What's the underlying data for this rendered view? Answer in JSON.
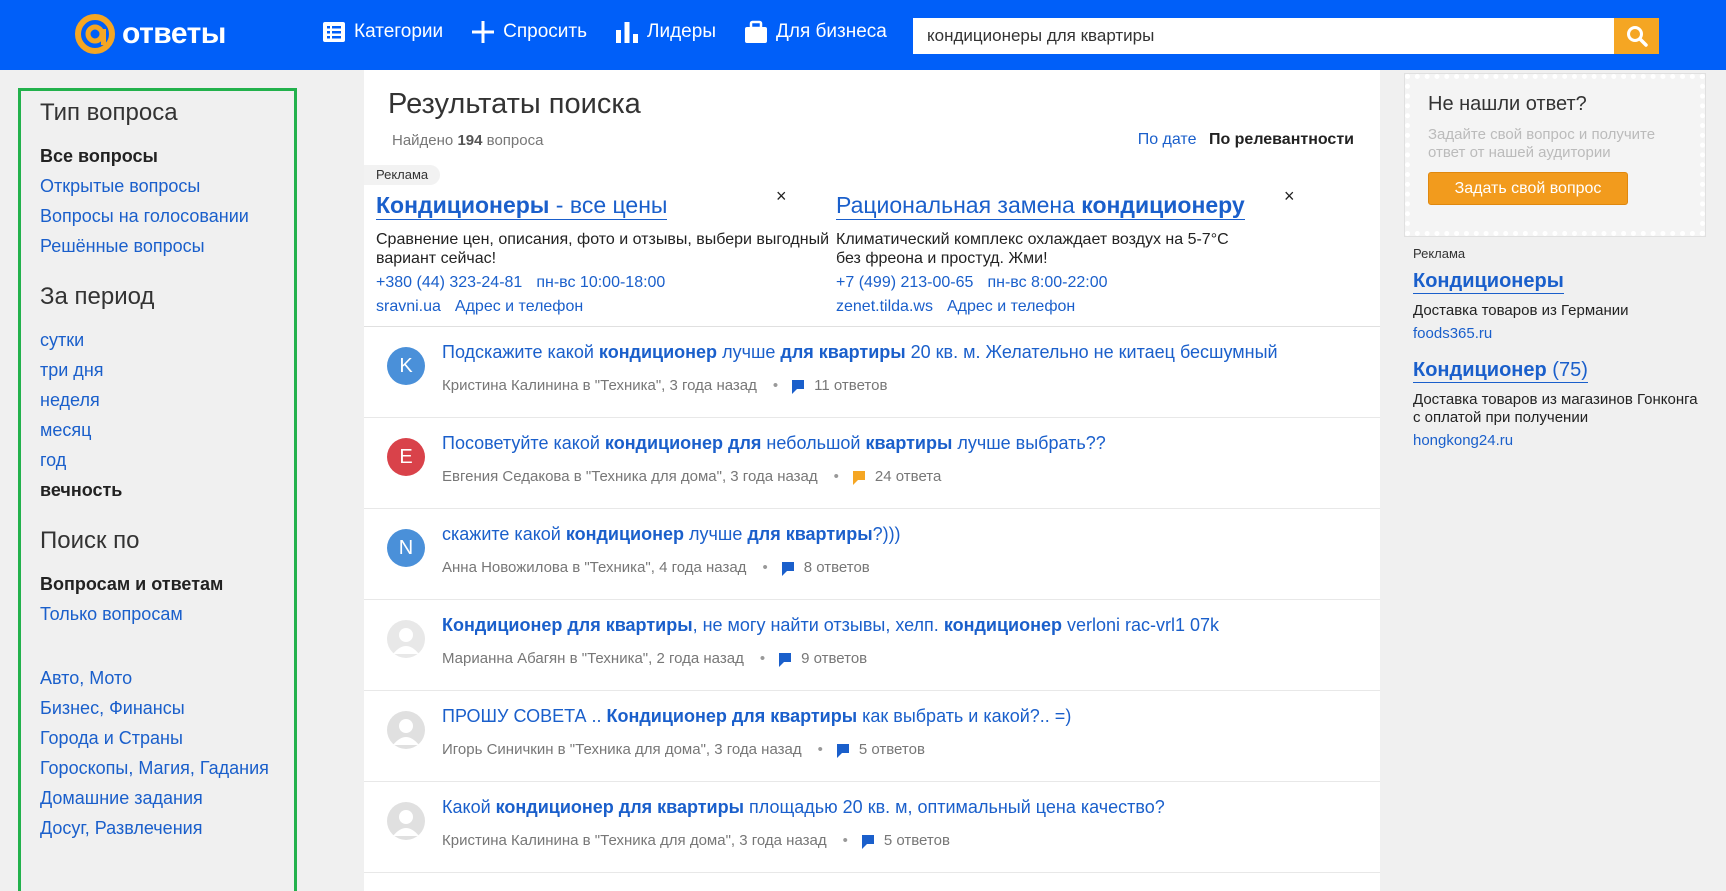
{
  "header": {
    "logo_text": "ответы",
    "nav": {
      "categories": "Категории",
      "ask": "Спросить",
      "leaders": "Лидеры",
      "business": "Для бизнеса"
    },
    "search_value": "кондиционеры для квартиры"
  },
  "sidebar": {
    "type_heading": "Тип вопроса",
    "type_items": [
      "Все вопросы",
      "Открытые вопросы",
      "Вопросы на голосовании",
      "Решённые вопросы"
    ],
    "period_heading": "За период",
    "period_items": [
      "сутки",
      "три дня",
      "неделя",
      "месяц",
      "год",
      "вечность"
    ],
    "searchby_heading": "Поиск по",
    "searchby_items": [
      "Вопросам и ответам",
      "Только вопросам"
    ],
    "categories": [
      "Авто, Мото",
      "Бизнес, Финансы",
      "Города и Страны",
      "Гороскопы, Магия, Гадания",
      "Домашние задания",
      "Досуг, Развлечения"
    ]
  },
  "main": {
    "title": "Результаты поиска",
    "found_prefix": "Найдено",
    "found_count": "194",
    "found_suffix": "вопроса",
    "sort_date": "По дате",
    "sort_relevance": "По релевантности",
    "ad_label": "Реклама",
    "close_symbol": "×",
    "ads": [
      {
        "title_bold": "Кондиционеры",
        "title_rest": " - все цены",
        "desc": "Сравнение цен, описания, фото и отзывы, выбери выгодный вариант сейчас!",
        "phone": "+380 (44) 323-24-81",
        "hours": "пн-вс 10:00-18:00",
        "domain": "sravni.ua",
        "address": "Адрес и телефон"
      },
      {
        "title_rest": "Рациональная замена ",
        "title_bold": "кондиционеру",
        "desc": "Климатический комплекс охлаждает воздух на 5-7°C без фреона и простуд. Жми!",
        "phone": "+7 (499) 213-00-65",
        "hours": "пн-вс 8:00-22:00",
        "domain": "zenet.tilda.ws",
        "address": "Адрес и телефон"
      }
    ],
    "questions": [
      {
        "avatar_letter": "K",
        "avatar_color": "#4a90d9",
        "title_parts": [
          [
            "Подскажите какой ",
            false
          ],
          [
            "кондиционер",
            true
          ],
          [
            " лучше ",
            false
          ],
          [
            "для квартиры",
            true
          ],
          [
            " 20 кв. м. Желательно не китаец бесшумный",
            false
          ]
        ],
        "meta": "Кристина Калинина в \"Техника\", 3 года назад",
        "answers": "11 ответов",
        "bubble_color": "#1a5fcb"
      },
      {
        "avatar_letter": "E",
        "avatar_color": "#d9424a",
        "title_parts": [
          [
            "Посоветуйте какой ",
            false
          ],
          [
            "кондиционер для",
            true
          ],
          [
            " небольшой ",
            false
          ],
          [
            "квартиры",
            true
          ],
          [
            " лучше выбрать??",
            false
          ]
        ],
        "meta": "Евгения Седакова в \"Техника для дома\", 3 года назад",
        "answers": "24 ответа",
        "bubble_color": "#f5a623"
      },
      {
        "avatar_letter": "N",
        "avatar_color": "#4a90d9",
        "title_parts": [
          [
            "скажите какой ",
            false
          ],
          [
            "кондиционер",
            true
          ],
          [
            " лучше ",
            false
          ],
          [
            "для квартиры",
            true
          ],
          [
            "?)))",
            false
          ]
        ],
        "meta": "Анна Новожилова в \"Техника\", 4 года назад",
        "answers": "8 ответов",
        "bubble_color": "#1a5fcb"
      },
      {
        "avatar_letter": "",
        "avatar_color": "#e8e8e8",
        "title_parts": [
          [
            "Кондиционер для квартиры",
            true
          ],
          [
            ", не могу найти отзывы, хелп. ",
            false
          ],
          [
            "кондиционер",
            true
          ],
          [
            " verloni rac-vrl1 07k",
            false
          ]
        ],
        "meta": "Марианна Абагян в \"Техника\", 2 года назад",
        "answers": "9 ответов",
        "bubble_color": "#1a5fcb"
      },
      {
        "avatar_letter": "",
        "avatar_color": "#e0e0e0",
        "title_parts": [
          [
            "ПРОШУ СОВЕТА .. ",
            false
          ],
          [
            "Кондиционер для квартиры",
            true
          ],
          [
            " как выбрать и какой?.. =)",
            false
          ]
        ],
        "meta": "Игорь Синичкин в \"Техника для дома\", 3 года назад",
        "answers": "5 ответов",
        "bubble_color": "#1a5fcb"
      },
      {
        "avatar_letter": "",
        "avatar_color": "#e0e0e0",
        "title_parts": [
          [
            "Какой ",
            false
          ],
          [
            "кондиционер для квартиры",
            true
          ],
          [
            " площадью 20 кв. м, оптимальный цена качество?",
            false
          ]
        ],
        "meta": "Кристина Калинина в \"Техника для дома\", 3 года назад",
        "answers": "5 ответов",
        "bubble_color": "#1a5fcb"
      }
    ]
  },
  "right": {
    "nf_title": "Не нашли ответ?",
    "nf_sub": "Задайте свой вопрос и получите ответ от нашей аудитории",
    "nf_button": "Задать свой вопрос",
    "ad_label": "Реклама",
    "ads": [
      {
        "title_bold": "Кондиционеры",
        "title_rest": "",
        "desc": "Доставка товаров из Германии",
        "url": "foods365.ru"
      },
      {
        "title_bold": "Кондиционер",
        "title_rest": " (75)",
        "desc": "Доставка товаров из магазинов Гонконга с оплатой при получении",
        "url": "hongkong24.ru"
      }
    ]
  },
  "colors": {
    "header_bg": "#005ff9",
    "link": "#1a5fcb",
    "accent_orange": "#f5a623",
    "sidebar_border": "#22b14c"
  },
  "icons": [
    "logo-at-icon",
    "list-icon",
    "plus-icon",
    "bar-chart-icon",
    "briefcase-icon",
    "search-icon",
    "answer-bubble-icon",
    "close-icon"
  ]
}
